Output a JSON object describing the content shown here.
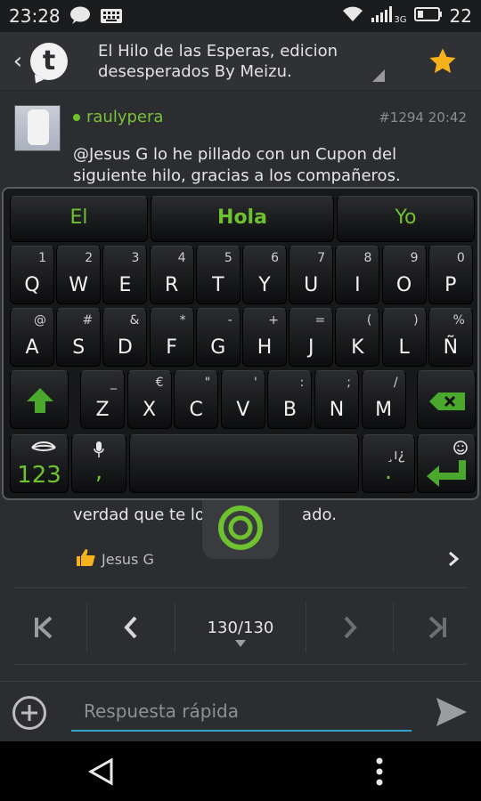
{
  "status_bar": {
    "time": "23:28",
    "network": "3G",
    "battery": "22"
  },
  "header": {
    "back_label": "‹",
    "title": "El Hilo de las Esperas, edicion desesperados By Meizu.",
    "logo_letter": "t"
  },
  "post": {
    "username": "raulypera",
    "number": "#1294",
    "time": "20:42",
    "text": "@Jesus G lo he pillado con un Cupon del siguiente hilo, gracias a los compañeros.",
    "partial_text": "verdad que te lo h",
    "partial_text_end": "ado.",
    "like_user": "Jesus G"
  },
  "keyboard": {
    "suggestions": [
      "El",
      "Hola",
      "Yo"
    ],
    "row1": [
      {
        "main": "Q",
        "sub": "1"
      },
      {
        "main": "W",
        "sub": "2"
      },
      {
        "main": "E",
        "sub": "3"
      },
      {
        "main": "R",
        "sub": "4"
      },
      {
        "main": "T",
        "sub": "5"
      },
      {
        "main": "Y",
        "sub": "6"
      },
      {
        "main": "U",
        "sub": "7"
      },
      {
        "main": "I",
        "sub": "8"
      },
      {
        "main": "O",
        "sub": "9"
      },
      {
        "main": "P",
        "sub": "0"
      }
    ],
    "row2": [
      {
        "main": "A",
        "sub": "@"
      },
      {
        "main": "S",
        "sub": "#"
      },
      {
        "main": "D",
        "sub": "&"
      },
      {
        "main": "F",
        "sub": "*"
      },
      {
        "main": "G",
        "sub": "-"
      },
      {
        "main": "H",
        "sub": "+"
      },
      {
        "main": "J",
        "sub": "="
      },
      {
        "main": "K",
        "sub": "("
      },
      {
        "main": "L",
        "sub": ")"
      },
      {
        "main": "Ñ",
        "sub": "%"
      }
    ],
    "row3": [
      {
        "main": "Z",
        "sub": "_"
      },
      {
        "main": "X",
        "sub": "€"
      },
      {
        "main": "C",
        "sub": "\""
      },
      {
        "main": "V",
        "sub": "'"
      },
      {
        "main": "B",
        "sub": ":"
      },
      {
        "main": "N",
        "sub": ";"
      },
      {
        "main": "M",
        "sub": "/"
      }
    ],
    "numbers_label": "123",
    "comma_label": ",",
    "punct_label": "¸ı¿",
    "period_label": ".",
    "accent_color": "#6fc22f"
  },
  "pager": {
    "current": "130",
    "total": "130",
    "label": "130/130"
  },
  "reply": {
    "placeholder": "Respuesta rápida",
    "accent_color": "#2ea6c9"
  }
}
